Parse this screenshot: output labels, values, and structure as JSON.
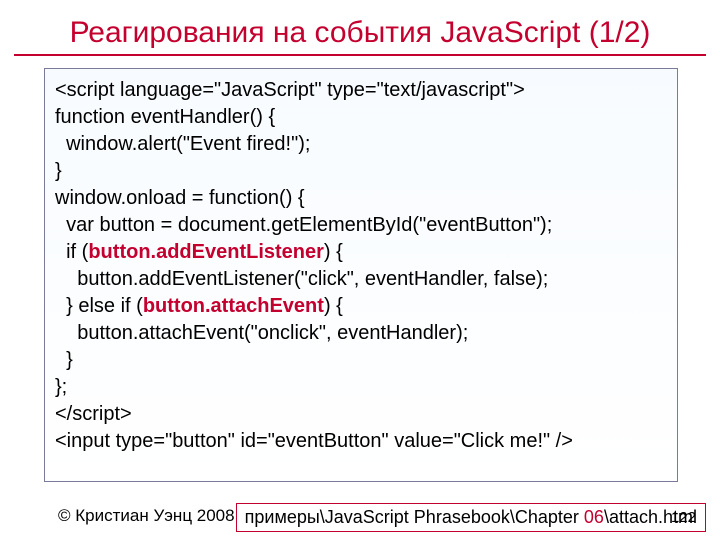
{
  "title": "Реагирования на события JavaScript (1/2)",
  "code": {
    "l1": "<script language=\"JavaScript\" type=\"text/javascript\">",
    "l2": "function eventHandler() {",
    "l3": "  window.alert(\"Event fired!\");",
    "l4": "}",
    "l5": "window.onload = function() {",
    "l6": "  var button = document.getElementById(\"eventButton\");",
    "l7a": "  if (",
    "l7b": "button.addEventListener",
    "l7c": ") {",
    "l8": "    button.addEventListener(\"click\", eventHandler, false);",
    "l9a": "  } else if (",
    "l9b": "button.attachEvent",
    "l9c": ") {",
    "l10": "    button.attachEvent(\"onclick\", eventHandler);",
    "l11": "  }",
    "l12": "};",
    "l13": "</script>",
    "l14": "<input type=\"button\" id=\"eventButton\" value=\"Click me!\" />"
  },
  "footer": {
    "copyright": "© Кристиан Уэнц 2008",
    "path_prefix": "примеры\\JavaScript Phrasebook\\Chapter ",
    "path_chapter": "06",
    "path_file": "\\attach.html",
    "page": "122"
  }
}
